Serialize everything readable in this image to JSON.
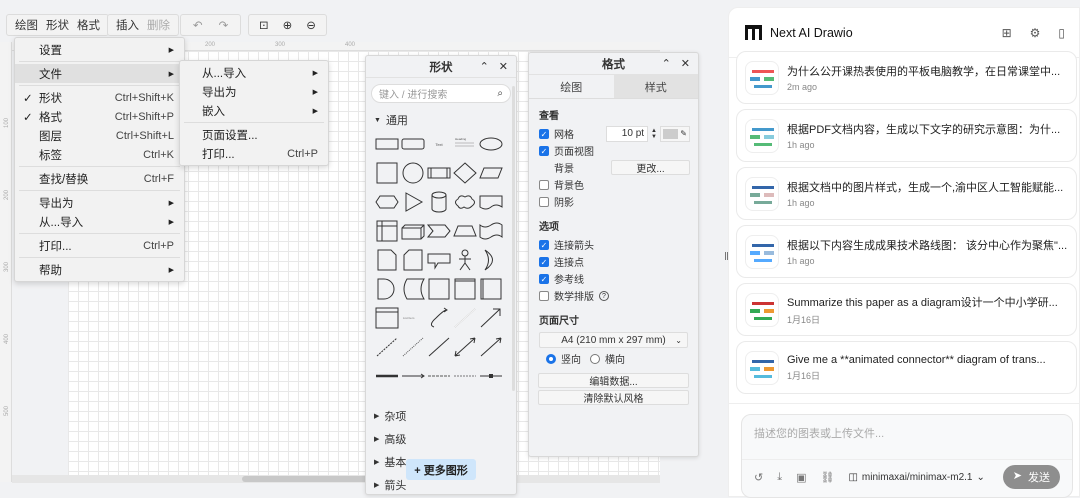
{
  "toolbar": {
    "draw": "绘图",
    "shape": "形状",
    "format": "格式",
    "insert": "插入",
    "delete": "删除"
  },
  "ruler": {
    "h": [
      "200",
      "300",
      "400"
    ],
    "v": [
      "100",
      "200",
      "300",
      "400",
      "500"
    ]
  },
  "main_menu": [
    {
      "label": "设置",
      "arrow": true
    },
    {
      "label": "文件",
      "arrow": true,
      "highlight": true
    },
    {
      "label": "形状",
      "shortcut": "Ctrl+Shift+K",
      "checked": true
    },
    {
      "label": "格式",
      "shortcut": "Ctrl+Shift+P",
      "checked": true
    },
    {
      "label": "图层",
      "shortcut": "Ctrl+Shift+L"
    },
    {
      "label": "标签",
      "shortcut": "Ctrl+K"
    },
    {
      "label": "查找/替换",
      "shortcut": "Ctrl+F"
    },
    {
      "label": "导出为",
      "arrow": true
    },
    {
      "label": "从...导入",
      "arrow": true
    },
    {
      "label": "打印...",
      "shortcut": "Ctrl+P"
    },
    {
      "label": "帮助",
      "arrow": true
    }
  ],
  "file_submenu": [
    {
      "label": "从...导入",
      "arrow": true
    },
    {
      "label": "导出为",
      "arrow": true
    },
    {
      "label": "嵌入",
      "arrow": true
    },
    {
      "label": "页面设置..."
    },
    {
      "label": "打印...",
      "shortcut": "Ctrl+P"
    }
  ],
  "shapes_panel": {
    "title": "形状",
    "search_placeholder": "键入 / 进行搜索",
    "general": "通用",
    "text_shape": "Text",
    "heading_shape": "Heading",
    "list_item": "List Item",
    "shapes": [
      "rect",
      "rounded-rect",
      "text",
      "heading",
      "ellipse",
      "square",
      "circle",
      "process",
      "diamond",
      "parallelogram",
      "hexagon",
      "triangle",
      "cylinder",
      "cloud",
      "document",
      "internal-storage",
      "cube",
      "step",
      "trapezoid",
      "tape",
      "note",
      "card",
      "callout",
      "actor",
      "or",
      "and",
      "data-storage",
      "square2",
      "frame",
      "partial-rect",
      "list",
      "list-item",
      "curve",
      "bidirectional-arrow",
      "arrow",
      "dashed-line",
      "dotted-line",
      "line",
      "bidirectional-connector",
      "directional-connector",
      "link",
      "connector-label",
      "connector-2-labels",
      "connector-3-labels",
      "connector-symbol"
    ],
    "sections": [
      "杂项",
      "高级",
      "基本",
      "箭头"
    ],
    "more_shapes": "+ 更多图形"
  },
  "format_panel": {
    "title": "格式",
    "tab_diagram": "绘图",
    "tab_style": "样式",
    "view": "查看",
    "grid": "网格",
    "grid_size": "10 pt",
    "page_view": "页面视图",
    "background": "背景",
    "change": "更改...",
    "bg_color": "背景色",
    "shadow": "阴影",
    "options": "选项",
    "connection_arrows": "连接箭头",
    "connection_points": "连接点",
    "guides": "参考线",
    "math": "数学排版",
    "page_size": "页面尺寸",
    "paper": "A4 (210 mm x 297 mm)",
    "portrait": "竖向",
    "landscape": "横向",
    "edit_data": "编辑数据...",
    "clear_style": "清除默认风格",
    "checks": {
      "grid": true,
      "page_view": true,
      "bg_color": false,
      "shadow": false,
      "connection_arrows": true,
      "connection_points": true,
      "guides": true,
      "math": false
    }
  },
  "chat": {
    "app_name": "Next AI Drawio",
    "history": [
      {
        "title": "为什么公开课热表使用的平板电脑教学，在日常课堂中...",
        "time": "2m ago"
      },
      {
        "title": "根据PDF文档内容，生成以下文字的研究示意图：为什...",
        "time": "1h ago"
      },
      {
        "title": "根据文档中的图片样式，生成一个,渝中区人工智能赋能...",
        "time": "1h ago"
      },
      {
        "title": "根据以下内容生成成果技术路线图： 该分中心作为聚焦\"...",
        "time": "1h ago"
      },
      {
        "title": "Summarize this paper as a diagram设计一个中小学研...",
        "time": "1月16日"
      },
      {
        "title": "Give me a **animated connector** diagram of trans...",
        "time": "1月16日"
      }
    ],
    "input_placeholder": "描述您的图表或上传文件...",
    "model": "minimaxai/minimax-m2.1",
    "send": "发送"
  },
  "colors": {
    "accent": "#1a73e8",
    "more_shapes_bg": "#cfe6fb",
    "send_bg": "#8e8e8e"
  }
}
